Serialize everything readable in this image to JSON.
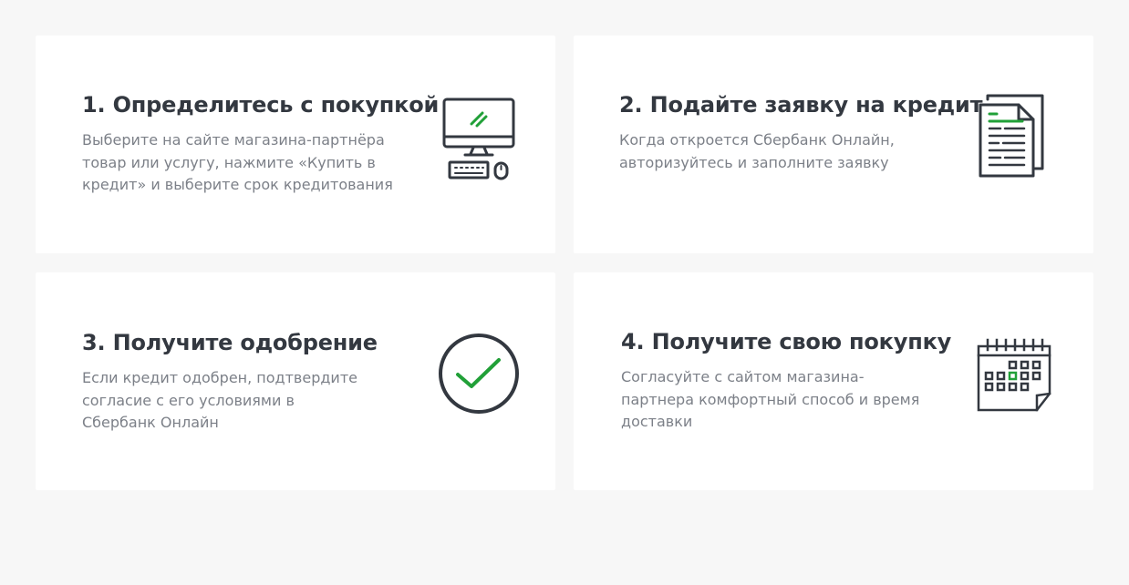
{
  "steps": [
    {
      "title": "1. Определитесь с покупкой",
      "description": "Выберите на сайте магазина-партнёра товар или услугу, нажмите «Купить в кредит» и выберите срок кредитования",
      "icon": "computer-icon"
    },
    {
      "title": "2. Подайте заявку на кредит",
      "description": "Когда откроется Сбербанк Онлайн, авторизуйтесь и заполните заявку",
      "icon": "document-icon"
    },
    {
      "title": "3. Получите одобрение",
      "description": "Если кредит одобрен, подтвердите согласие с его условиями в Сбербанк Онлайн",
      "icon": "checkmark-circle-icon"
    },
    {
      "title": "4. Получите свою покупку",
      "description": "Согласуйте с сайтом магазина-партнера комфортный способ и время доставки",
      "icon": "calendar-icon"
    }
  ],
  "colors": {
    "background": "#f7f7f7",
    "card": "#ffffff",
    "title": "#333840",
    "text": "#7c8088",
    "icon_stroke": "#333840",
    "accent_green": "#21a038"
  }
}
